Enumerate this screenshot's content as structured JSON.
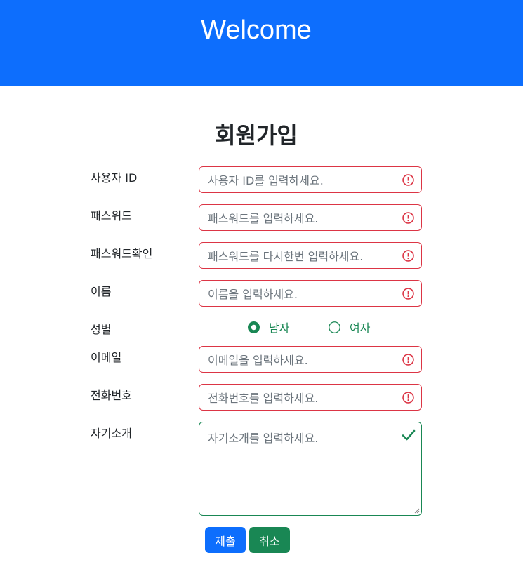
{
  "header": {
    "title": "Welcome"
  },
  "form": {
    "title": "회원가입",
    "fields": [
      {
        "label": "사용자 ID",
        "placeholder": "사용자 ID를 입력하세요.",
        "state": "invalid"
      },
      {
        "label": "패스워드",
        "placeholder": "패스워드를 입력하세요.",
        "state": "invalid"
      },
      {
        "label": "패스워드확인",
        "placeholder": "패스워드를 다시한번 입력하세요.",
        "state": "invalid"
      },
      {
        "label": "이름",
        "placeholder": "이름을 입력하세요.",
        "state": "invalid"
      },
      {
        "label": "이메일",
        "placeholder": "이메일을 입력하세요.",
        "state": "invalid"
      },
      {
        "label": "전화번호",
        "placeholder": "전화번호를 입력하세요.",
        "state": "invalid"
      }
    ],
    "gender": {
      "label": "성별",
      "options": [
        {
          "label": "남자",
          "selected": true
        },
        {
          "label": "여자",
          "selected": false
        }
      ]
    },
    "intro": {
      "label": "자기소개",
      "placeholder": "자기소개를 입력하세요.",
      "state": "valid"
    },
    "buttons": {
      "submit": "제출",
      "cancel": "취소"
    }
  },
  "colors": {
    "primary": "#0d6efd",
    "success": "#198754",
    "danger": "#dc3545",
    "placeholder": "#6c757d"
  },
  "icons": {
    "invalid": "exclamation-circle-icon",
    "valid": "checkmark-icon"
  }
}
